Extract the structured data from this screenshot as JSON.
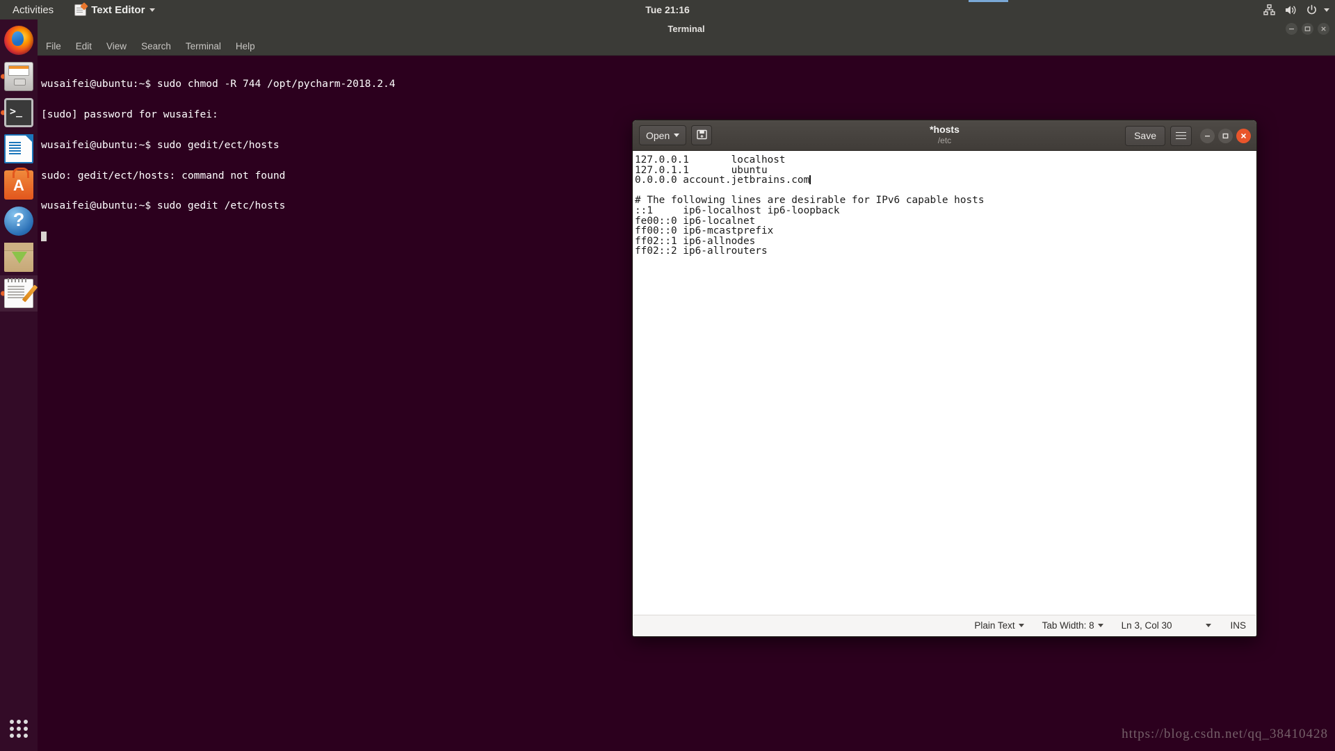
{
  "top_panel": {
    "activities": "Activities",
    "app_menu": {
      "label": "Text Editor",
      "icon": "text-editor-icon"
    },
    "clock": "Tue 21:16",
    "tray_icons": [
      "network-icon",
      "volume-icon",
      "power-icon",
      "chevron-down-icon"
    ]
  },
  "dock": {
    "items": [
      {
        "name": "firefox",
        "label": "Firefox Web Browser",
        "running": false
      },
      {
        "name": "files",
        "label": "Files",
        "running": true
      },
      {
        "name": "terminal",
        "label": "Terminal",
        "running": true
      },
      {
        "name": "writer",
        "label": "LibreOffice Writer",
        "running": false
      },
      {
        "name": "software",
        "label": "Ubuntu Software",
        "running": false
      },
      {
        "name": "help",
        "label": "Help",
        "running": false
      },
      {
        "name": "install",
        "label": "Install Ubuntu",
        "running": false
      },
      {
        "name": "gedit",
        "label": "Text Editor",
        "running": true
      }
    ],
    "show_apps": "Show Applications"
  },
  "terminal": {
    "title": "Terminal",
    "menus": [
      "File",
      "Edit",
      "View",
      "Search",
      "Terminal",
      "Help"
    ],
    "lines": [
      "wusaifei@ubuntu:~$ sudo chmod -R 744 /opt/pycharm-2018.2.4",
      "[sudo] password for wusaifei:",
      "wusaifei@ubuntu:~$ sudo gedit/ect/hosts",
      "sudo: gedit/ect/hosts: command not found",
      "wusaifei@ubuntu:~$ sudo gedit /etc/hosts"
    ],
    "window_controls": [
      "minimize",
      "maximize",
      "close"
    ]
  },
  "gedit": {
    "open_label": "Open",
    "save_label": "Save",
    "save_as_icon": "save-as-icon",
    "menu_icon": "hamburger-menu-icon",
    "title": "*hosts",
    "subtitle": "/etc",
    "document_lines": [
      "127.0.0.1       localhost",
      "127.0.1.1       ubuntu",
      "0.0.0.0 account.jetbrains.com",
      "",
      "# The following lines are desirable for IPv6 capable hosts",
      "::1     ip6-localhost ip6-loopback",
      "fe00::0 ip6-localnet",
      "ff00::0 ip6-mcastprefix",
      "ff02::1 ip6-allnodes",
      "ff02::2 ip6-allrouters"
    ],
    "caret_line_index": 2,
    "status": {
      "language": "Plain Text",
      "tab_width": "Tab Width: 8",
      "position": "Ln 3, Col 30",
      "insert_mode": "INS"
    },
    "window_controls": [
      "minimize",
      "maximize",
      "close"
    ]
  },
  "watermark": "https://blog.csdn.net/qq_38410428",
  "colors": {
    "panel": "#3b3b37",
    "terminal_bg": "#2c001e",
    "desktop": "#2c001e",
    "gedit_header": "#45413d",
    "close_red": "#e9552b",
    "accent_blue": "#7aa8d6"
  }
}
